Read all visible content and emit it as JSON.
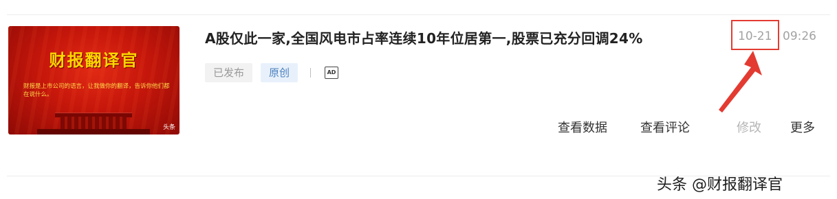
{
  "article": {
    "thumbnail": {
      "title": "财报翻译官",
      "subtitle": "财报是上市公司的语言，让我做你的翻译，告诉你他们都在说什么。",
      "watermark": "头条"
    },
    "title": "A股仅此一家,全国风电市占率连续10年位居第一,股票已充分回调24%",
    "status_label": "已发布",
    "original_label": "原创",
    "ad_icon_label": "AD",
    "date": "10-21",
    "time": "09:26"
  },
  "actions": {
    "view_data": "查看数据",
    "view_comments": "查看评论",
    "edit": "修改",
    "more": "更多"
  },
  "annotation": {
    "highlight_color": "#e33b31"
  },
  "page_watermark": "头条 @财报翻译官"
}
